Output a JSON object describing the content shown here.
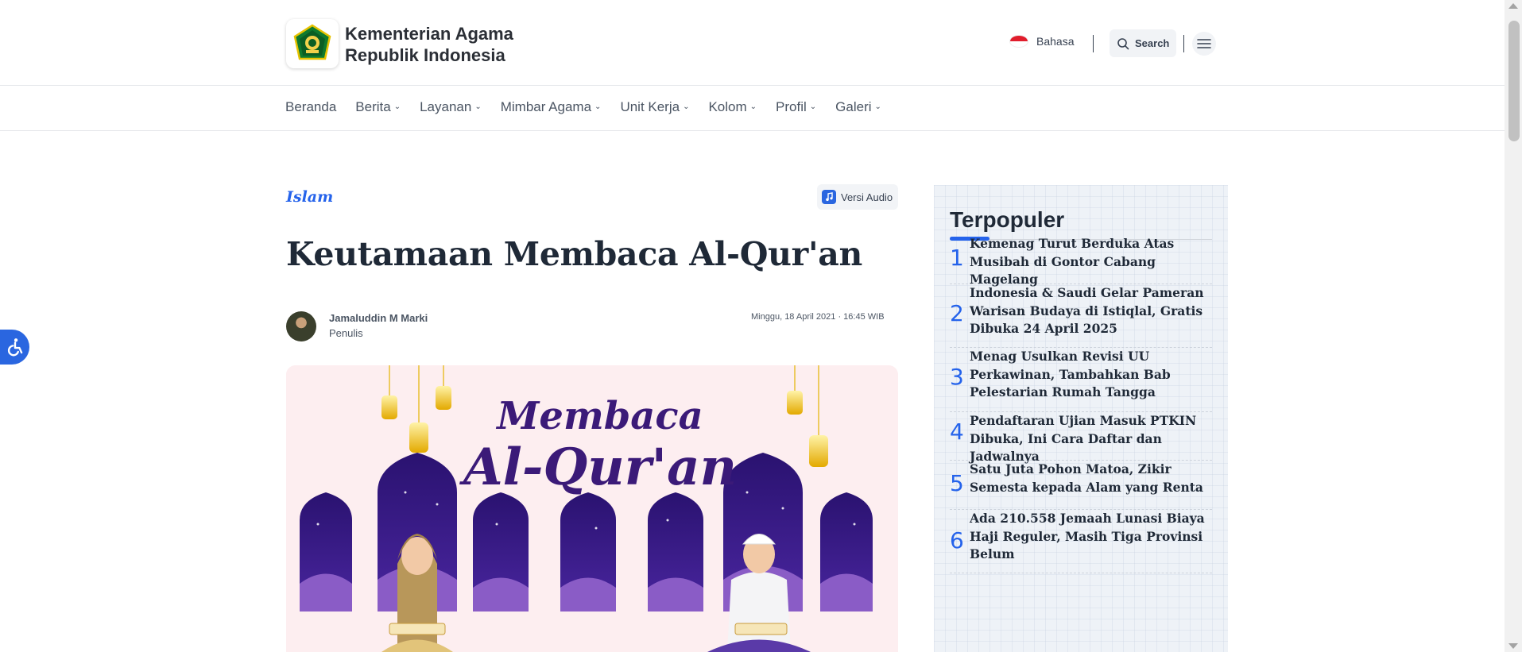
{
  "header": {
    "brand_line1": "Kementerian Agama",
    "brand_line2": "Republik Indonesia",
    "language_label": "Bahasa",
    "search_label": "Search"
  },
  "nav": {
    "items": [
      {
        "label": "Beranda",
        "has_dropdown": false
      },
      {
        "label": "Berita",
        "has_dropdown": true
      },
      {
        "label": "Layanan",
        "has_dropdown": true
      },
      {
        "label": "Mimbar Agama",
        "has_dropdown": true
      },
      {
        "label": "Unit Kerja",
        "has_dropdown": true
      },
      {
        "label": "Kolom",
        "has_dropdown": true
      },
      {
        "label": "Profil",
        "has_dropdown": true
      },
      {
        "label": "Galeri",
        "has_dropdown": true
      }
    ]
  },
  "article": {
    "category": "Islam",
    "audio_label": "Versi Audio",
    "title": "Keutamaan Membaca Al-Qur'an",
    "author_name": "Jamaluddin M Marki",
    "author_role": "Penulis",
    "published": "Minggu, 18 April 2021 · 16:45 WIB",
    "hero_text_line1": "Membaca",
    "hero_text_line2": "Al-Qur'an"
  },
  "sidebar": {
    "title": "Terpopuler",
    "items": [
      {
        "num": "1",
        "text": "Kemenag Turut Berduka Atas Musibah di Gontor Cabang Magelang"
      },
      {
        "num": "2",
        "text": "Indonesia & Saudi Gelar Pameran Warisan Budaya di Istiqlal, Gratis Dibuka 24 April 2025"
      },
      {
        "num": "3",
        "text": "Menag Usulkan Revisi UU Perkawinan, Tambahkan Bab Pelestarian Rumah Tangga"
      },
      {
        "num": "4",
        "text": "Pendaftaran Ujian Masuk PTKIN Dibuka, Ini Cara Daftar dan Jadwalnya"
      },
      {
        "num": "5",
        "text": "Satu Juta Pohon Matoa, Zikir Semesta kepada Alam yang Renta"
      },
      {
        "num": "6",
        "text": "Ada 210.558 Jemaah Lunasi Biaya Haji Reguler, Masih Tiga Provinsi Belum"
      }
    ]
  },
  "colors": {
    "accent": "#2563eb",
    "sidebar_bg": "#eef2f7",
    "hero_bg": "#fdeef0",
    "hero_purple": "#3b1a78"
  }
}
